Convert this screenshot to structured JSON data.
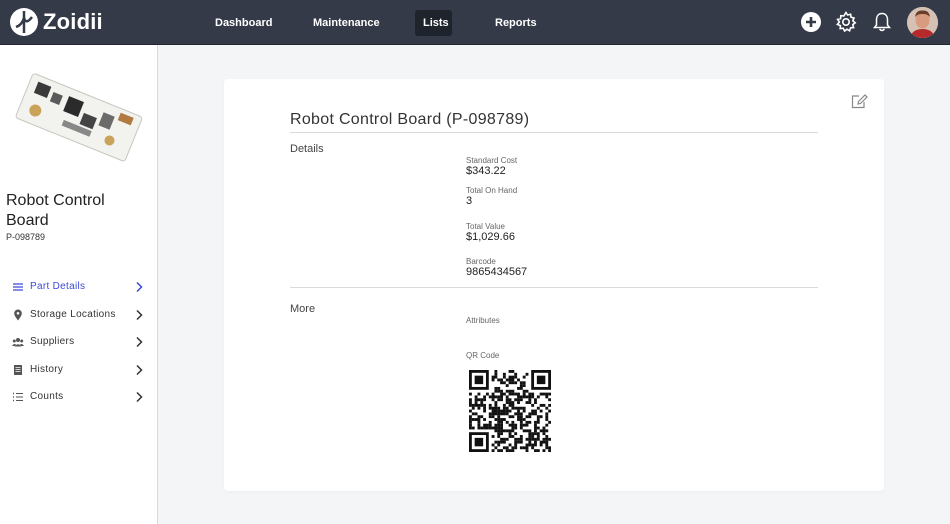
{
  "app": {
    "name": "Zoidii"
  },
  "nav": {
    "items": [
      {
        "label": "Dashboard"
      },
      {
        "label": "Maintenance"
      },
      {
        "label": "Lists"
      },
      {
        "label": "Reports"
      }
    ],
    "active": "Lists"
  },
  "top_icons": [
    "plus-circle-icon",
    "gear-icon",
    "bell-icon",
    "user-avatar"
  ],
  "sidebar": {
    "part_name": "Robot Control Board",
    "part_number": "P-098789",
    "items": [
      {
        "label": "Part Details",
        "icon": "list-icon",
        "active": true
      },
      {
        "label": "Storage Locations",
        "icon": "map-pin-icon"
      },
      {
        "label": "Suppliers",
        "icon": "users-icon"
      },
      {
        "label": "History",
        "icon": "book-icon"
      },
      {
        "label": "Counts",
        "icon": "list-ordered-icon"
      }
    ]
  },
  "card": {
    "title": "Robot Control Board (P-098789)",
    "details_label": "Details",
    "fields": [
      {
        "label": "Standard Cost",
        "value": "$343.22"
      },
      {
        "label": "Total On Hand",
        "value": "3"
      },
      {
        "label": "Total Value",
        "value": "$1,029.66"
      },
      {
        "label": "Barcode",
        "value": "9865434567"
      }
    ],
    "more_label": "More",
    "attributes_label": "Attributes",
    "qr_label": "QR Code"
  },
  "colors": {
    "topbar": "#343a48",
    "accent": "#3a4ad6",
    "page_bg": "#f4f5f7"
  }
}
